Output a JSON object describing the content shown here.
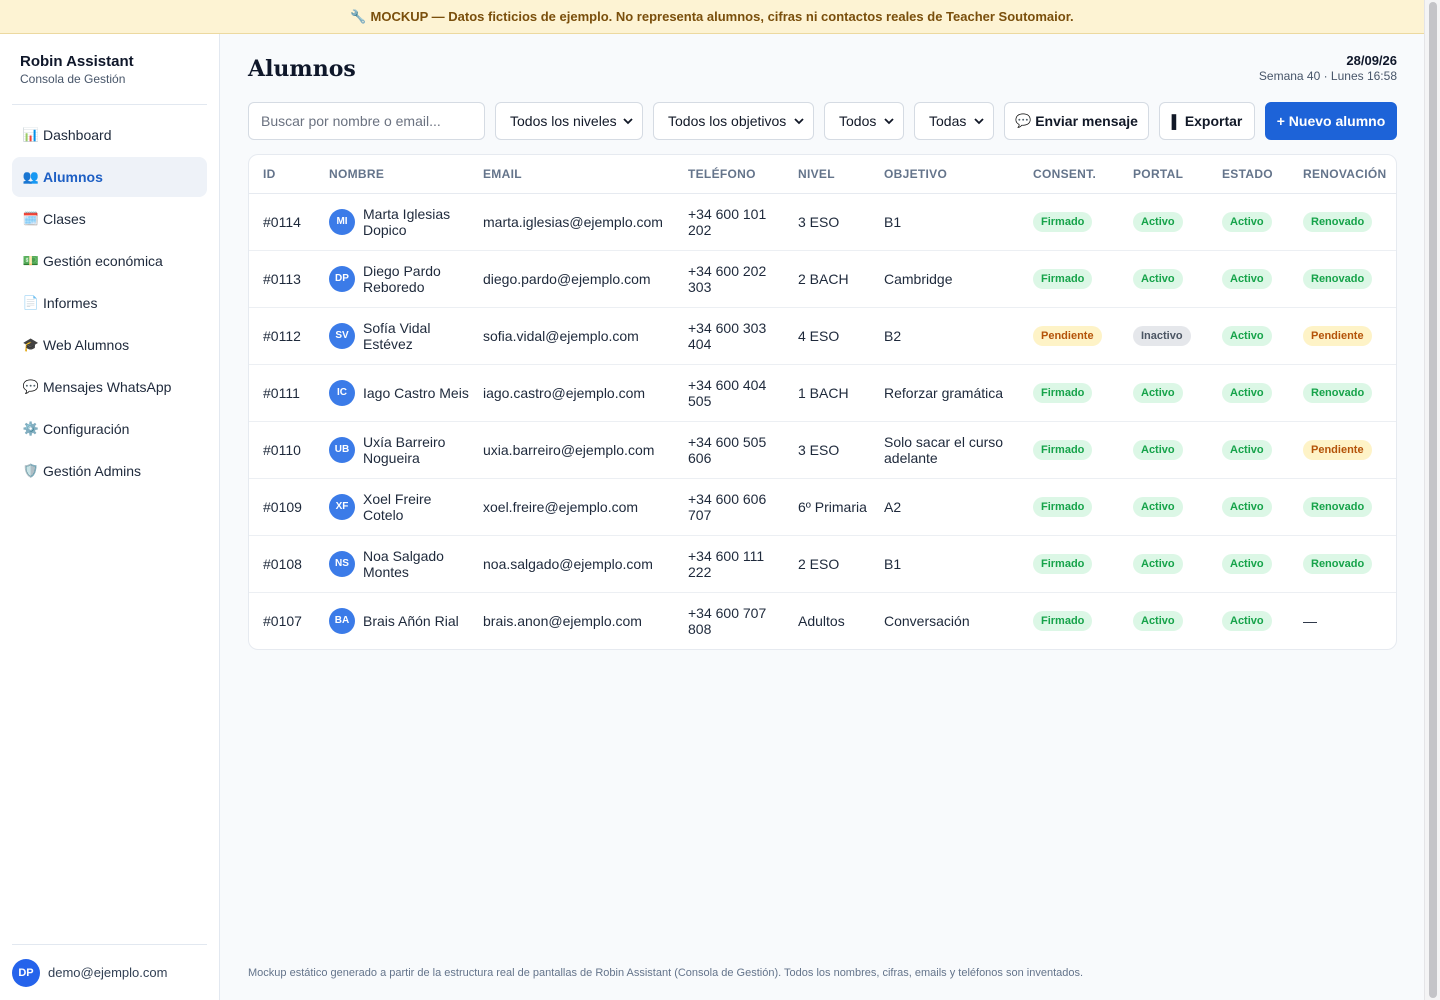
{
  "banner": {
    "text": "MOCKUP — Datos ficticios de ejemplo. No representa alumnos, cifras ni contactos reales de Teacher Soutomaior.",
    "icon": "wrench-icon"
  },
  "sidebar": {
    "title": "Robin Assistant",
    "subtitle": "Consola de Gestión",
    "items": [
      {
        "label": "Dashboard",
        "icon": "📊",
        "active": false
      },
      {
        "label": "Alumnos",
        "icon": "👥",
        "active": true
      },
      {
        "label": "Clases",
        "icon": "🗓️",
        "active": false
      },
      {
        "label": "Gestión económica",
        "icon": "💵",
        "active": false
      },
      {
        "label": "Informes",
        "icon": "📄",
        "active": false
      },
      {
        "label": "Web Alumnos",
        "icon": "🎓",
        "active": false
      },
      {
        "label": "Mensajes WhatsApp",
        "icon": "💬",
        "active": false
      },
      {
        "label": "Configuración",
        "icon": "⚙️",
        "active": false
      },
      {
        "label": "Gestión Admins",
        "icon": "🛡️",
        "active": false
      }
    ],
    "user": {
      "initials": "DP",
      "email": "demo@ejemplo.com"
    }
  },
  "header": {
    "title": "Alumnos",
    "date": "28/09/26",
    "week": "Semana 40 · Lunes 16:58"
  },
  "toolbar": {
    "search_placeholder": "Buscar por nombre o email...",
    "filter_level": "Todos los niveles",
    "filter_goal": "Todos los objetivos",
    "filter_status": "Todos",
    "filter_renewal": "Todas",
    "send_label": "Enviar mensaje",
    "export_label": "Exportar",
    "new_label": "+ Nuevo alumno"
  },
  "table": {
    "columns": [
      "ID",
      "NOMBRE",
      "EMAIL",
      "TELÉFONO",
      "NIVEL",
      "OBJETIVO",
      "CONSENT.",
      "PORTAL",
      "ESTADO",
      "RENOVACIÓN"
    ],
    "rows": [
      {
        "id": "#0114",
        "initials": "MI",
        "name": "Marta Iglesias Dopico",
        "email": "marta.iglesias@ejemplo.com",
        "phone": "+34 600 101 202",
        "level": "3 ESO",
        "goal": "B1",
        "consent": "Firmado",
        "portal": "Activo",
        "status": "Activo",
        "renewal": "Renovado"
      },
      {
        "id": "#0113",
        "initials": "DP",
        "name": "Diego Pardo Reboredo",
        "email": "diego.pardo@ejemplo.com",
        "phone": "+34 600 202 303",
        "level": "2 BACH",
        "goal": "Cambridge",
        "consent": "Firmado",
        "portal": "Activo",
        "status": "Activo",
        "renewal": "Renovado"
      },
      {
        "id": "#0112",
        "initials": "SV",
        "name": "Sofía Vidal Estévez",
        "email": "sofia.vidal@ejemplo.com",
        "phone": "+34 600 303 404",
        "level": "4 ESO",
        "goal": "B2",
        "consent": "Pendiente",
        "portal": "Inactivo",
        "status": "Activo",
        "renewal": "Pendiente"
      },
      {
        "id": "#0111",
        "initials": "IC",
        "name": "Iago Castro Meis",
        "email": "iago.castro@ejemplo.com",
        "phone": "+34 600 404 505",
        "level": "1 BACH",
        "goal": "Reforzar gramática",
        "consent": "Firmado",
        "portal": "Activo",
        "status": "Activo",
        "renewal": "Renovado"
      },
      {
        "id": "#0110",
        "initials": "UB",
        "name": "Uxía Barreiro Nogueira",
        "email": "uxia.barreiro@ejemplo.com",
        "phone": "+34 600 505 606",
        "level": "3 ESO",
        "goal": "Solo sacar el curso adelante",
        "consent": "Firmado",
        "portal": "Activo",
        "status": "Activo",
        "renewal": "Pendiente"
      },
      {
        "id": "#0109",
        "initials": "XF",
        "name": "Xoel Freire Cotelo",
        "email": "xoel.freire@ejemplo.com",
        "phone": "+34 600 606 707",
        "level": "6º Primaria",
        "goal": "A2",
        "consent": "Firmado",
        "portal": "Activo",
        "status": "Activo",
        "renewal": "Renovado"
      },
      {
        "id": "#0108",
        "initials": "NS",
        "name": "Noa Salgado Montes",
        "email": "noa.salgado@ejemplo.com",
        "phone": "+34 600 111 222",
        "level": "2 ESO",
        "goal": "B1",
        "consent": "Firmado",
        "portal": "Activo",
        "status": "Activo",
        "renewal": "Renovado"
      },
      {
        "id": "#0107",
        "initials": "BA",
        "name": "Brais Añón Rial",
        "email": "brais.anon@ejemplo.com",
        "phone": "+34 600 707 808",
        "level": "Adultos",
        "goal": "Conversación",
        "consent": "Firmado",
        "portal": "Activo",
        "status": "Activo",
        "renewal": "—"
      }
    ]
  },
  "footer": "Mockup estático generado a partir de la estructura real de pantallas de Robin Assistant (Consola de Gestión). Todos los nombres, cifras, emails y teléfonos son inventados.",
  "colors": {
    "accent": "#1d63d8",
    "badge_green": "#16a34a",
    "badge_amber": "#b45309",
    "badge_gray": "#4b5563",
    "banner_bg": "#fdf3d3"
  }
}
